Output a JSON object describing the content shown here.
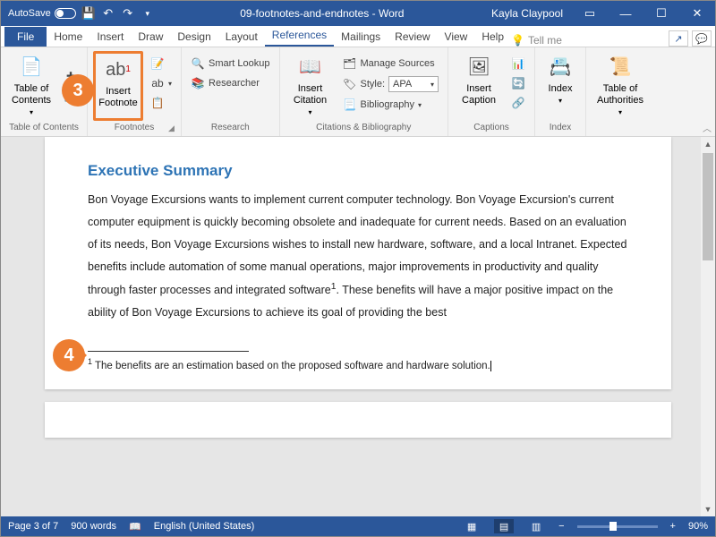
{
  "titlebar": {
    "autosave_label": "AutoSave",
    "autosave_state": "Off",
    "doc_title": "09-footnotes-and-endnotes - Word",
    "user": "Kayla Claypool"
  },
  "tabs": {
    "file": "File",
    "items": [
      "Home",
      "Insert",
      "Draw",
      "Design",
      "Layout",
      "References",
      "Mailings",
      "Review",
      "View",
      "Help"
    ],
    "active_index": 5,
    "tellme": "Tell me"
  },
  "ribbon": {
    "toc": {
      "group": "Table of Contents",
      "btn": "Table of\nContents"
    },
    "footnotes": {
      "group": "Footnotes",
      "insert_footnote": "Insert\nFootnote",
      "insert_endnote": "Insert Endnote",
      "next_footnote": "Next Footnote",
      "show_notes": "Show Notes",
      "ab_badge": "ab",
      "ab_sup": "1"
    },
    "research": {
      "group": "Research",
      "smart_lookup": "Smart Lookup",
      "researcher": "Researcher"
    },
    "citations": {
      "group": "Citations & Bibliography",
      "insert_citation": "Insert\nCitation",
      "manage_sources": "Manage Sources",
      "style_label": "Style:",
      "style_value": "APA",
      "bibliography": "Bibliography"
    },
    "captions": {
      "group": "Captions",
      "insert_caption": "Insert\nCaption"
    },
    "index": {
      "group": "Index",
      "btn": "Index"
    },
    "toa": {
      "group": "",
      "btn": "Table of\nAuthorities"
    }
  },
  "callouts": {
    "c3": "3",
    "c4": "4"
  },
  "document": {
    "heading": "Executive Summary",
    "body_1": "Bon Voyage Excursions wants to implement current computer technology. Bon Voyage Excursion's current computer equipment is quickly becoming obsolete and inadequate for current needs. Based on an evaluation of its needs, Bon Voyage Excursions wishes to install new hardware, software, and a local Intranet. Expected benefits include automation of some manual operations, major improvements in productivity and quality through faster processes and integrated software",
    "body_sup": "1",
    "body_2": ". These benefits will have a major positive impact on the ability of Bon Voyage Excursions to achieve its goal of providing the best",
    "footnote_sup": "1",
    "footnote_text": " The benefits are an estimation based on the proposed software and hardware solution."
  },
  "statusbar": {
    "page": "Page 3 of 7",
    "words": "900 words",
    "lang": "English (United States)",
    "zoom_minus": "−",
    "zoom_plus": "+",
    "zoom": "90%"
  }
}
